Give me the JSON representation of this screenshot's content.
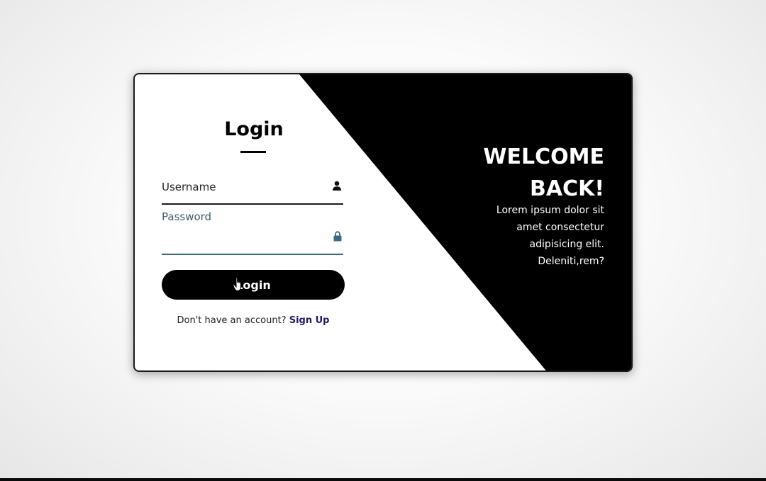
{
  "login": {
    "title": "Login",
    "username": {
      "label": "Username",
      "value": "",
      "icon": "user-icon"
    },
    "password": {
      "label": "Password",
      "value": "",
      "icon": "lock-icon"
    },
    "button_label": "Login",
    "signup_prompt": "Don't have an account?",
    "signup_link": "Sign Up"
  },
  "welcome": {
    "title_line1": "WELCOME",
    "title_line2": "BACK!",
    "text_line1": "Lorem ipsum dolor sit",
    "text_line2": "amet consectetur",
    "text_line3": "adipisicing elit.",
    "text_line4": "Deleniti,rem?"
  },
  "colors": {
    "panel": "#000000",
    "card": "#ffffff",
    "password_accent": "#3e6b84",
    "signup_link": "#1f1a66"
  }
}
